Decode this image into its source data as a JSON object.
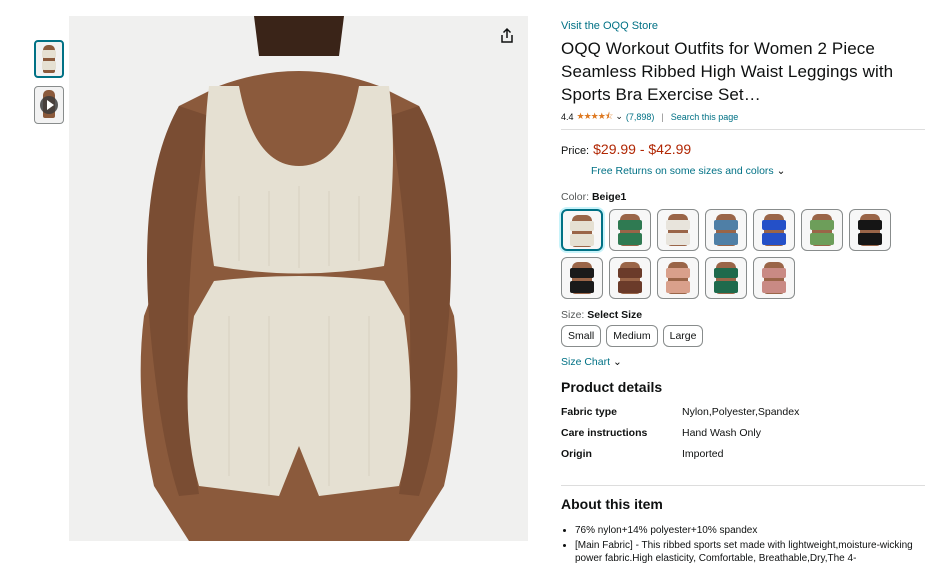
{
  "store_link": "Visit the OQQ Store",
  "title": "OQQ Workout Outfits for Women 2 Piece Seamless Ribbed High Waist Leggings with Sports Bra Exercise Set…",
  "rating": {
    "value": "4.4",
    "count": "(7,898)",
    "search": "Search this page",
    "stars": 4.4
  },
  "price": {
    "label": "Price:",
    "value": "$29.99 - $42.99",
    "returns": "Free Returns on some sizes and colors"
  },
  "color": {
    "label": "Color:",
    "selected": "Beige1",
    "swatches": [
      {
        "top": "#e5e0d2",
        "bottom": "#e5e0d2"
      },
      {
        "top": "#2f7a52",
        "bottom": "#2f7a52"
      },
      {
        "top": "#e8e4dc",
        "bottom": "#e8e4dc"
      },
      {
        "top": "#4f7fa6",
        "bottom": "#4f7fa6"
      },
      {
        "top": "#2450c8",
        "bottom": "#2450c8"
      },
      {
        "top": "#6d9e5a",
        "bottom": "#6d9e5a"
      },
      {
        "top": "#151515",
        "bottom": "#151515"
      },
      {
        "top": "#1a1a1a",
        "bottom": "#1a1a1a"
      },
      {
        "top": "#6b3b2a",
        "bottom": "#6b3b2a"
      },
      {
        "top": "#d9a08b",
        "bottom": "#d9a08b"
      },
      {
        "top": "#1e6a4c",
        "bottom": "#1e6a4c"
      },
      {
        "top": "#c98a84",
        "bottom": "#c98a84"
      }
    ]
  },
  "size": {
    "label": "Size:",
    "selected": "Select Size",
    "options": [
      "Small",
      "Medium",
      "Large"
    ],
    "chart": "Size Chart"
  },
  "details": {
    "heading": "Product details",
    "rows": [
      {
        "key": "Fabric type",
        "value": "Nylon,Polyester,Spandex"
      },
      {
        "key": "Care instructions",
        "value": "Hand Wash Only"
      },
      {
        "key": "Origin",
        "value": "Imported"
      }
    ]
  },
  "about": {
    "heading": "About this item",
    "bullets": [
      "76% nylon+14% polyester+10% spandex",
      "[Main Fabric] - This ribbed sports set made with lightweight,moisture-wicking power fabric.High elasticity, Comfortable, Breathable,Dry,The 4-"
    ]
  },
  "colors": {
    "link": "#007185",
    "price": "#b12704",
    "star": "#de7921",
    "outfit": "#e5e0d2",
    "skin": "#8b5a3c"
  }
}
